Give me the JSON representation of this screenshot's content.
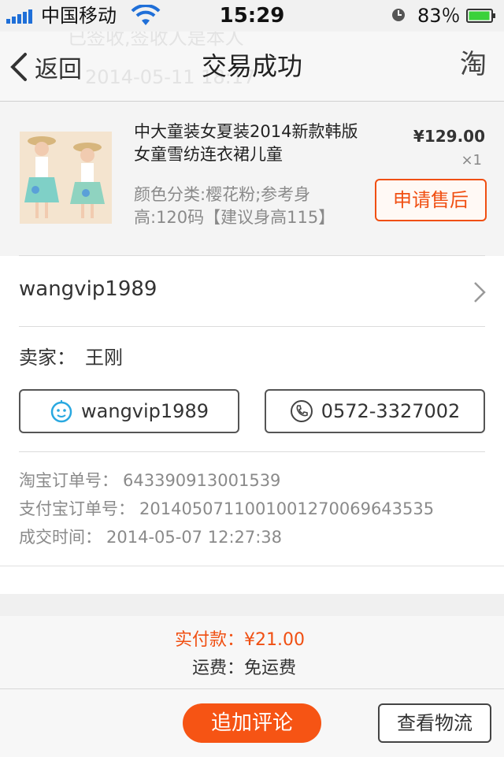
{
  "status_bar": {
    "carrier": "中国移动",
    "time": "15:29",
    "battery_pct": "83％",
    "signal_icon": "signal-bars-icon",
    "wifi_icon": "wifi-icon",
    "clock_icon": "alarm-clock-icon",
    "battery_icon": "battery-icon"
  },
  "nav": {
    "back_label": "返回",
    "title": "交易成功",
    "taobao_label": "淘",
    "ghost_text_top": "已签收,签收人是本人",
    "ghost_text": "2014-05-11 18:17"
  },
  "product": {
    "title": "中大童装女夏装2014新款韩版女童雪纺连衣裙儿童",
    "spec": "颜色分类:樱花粉;参考身高:120码【建议身高115】",
    "price": "¥129.00",
    "quantity": "×1",
    "after_sale_label": "申请售后"
  },
  "shop": {
    "name": "wangvip1989"
  },
  "seller": {
    "label": "卖家：",
    "name": "王刚",
    "wangwang_label": "wangvip1989",
    "phone_label": "0572-3327002"
  },
  "order": {
    "rows": [
      {
        "label": "淘宝订单号：",
        "value": "643390913001539"
      },
      {
        "label": "支付宝订单号：",
        "value": "2014050711001001270069643535"
      },
      {
        "label": "成交时间：",
        "value": "2014-05-07 12:27:38"
      }
    ]
  },
  "totals": {
    "paid": "实付款：¥21.00",
    "shipping": "运费：免运费"
  },
  "actions": {
    "review_label": "追加评论",
    "logistics_label": "查看物流"
  },
  "colors": {
    "accent": "#f04f12",
    "primary_button": "#f65414",
    "signal": "#1f6fd8",
    "battery": "#3bd13b"
  }
}
